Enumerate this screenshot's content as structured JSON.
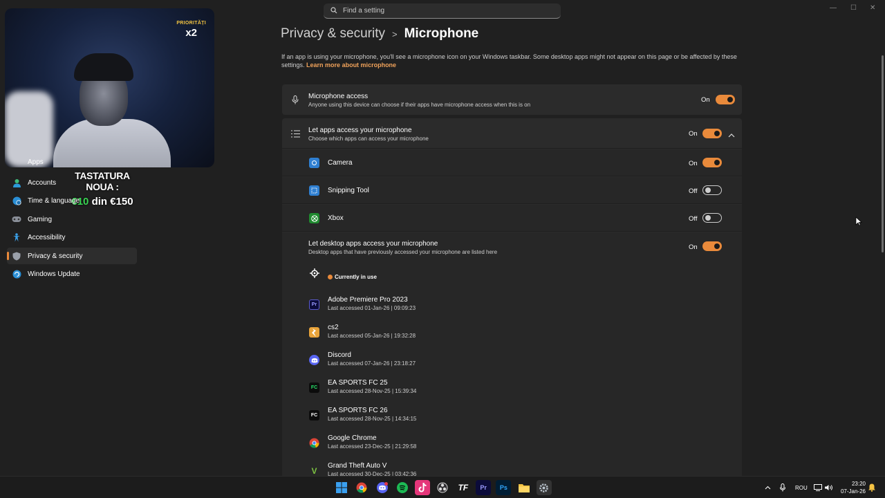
{
  "overlay": {
    "badge_top": "PRIORITĂȚI",
    "badge_bottom": "x2",
    "promo_line1": "TASTATURA NOUA :",
    "promo_highlight": "€10",
    "promo_rest": "din €150"
  },
  "search": {
    "placeholder": "Find a setting"
  },
  "sidebar": {
    "items": [
      {
        "label": "Apps",
        "icon": "apps-icon"
      },
      {
        "label": "Accounts",
        "icon": "accounts-icon"
      },
      {
        "label": "Time & language",
        "icon": "globe-clock-icon"
      },
      {
        "label": "Gaming",
        "icon": "gamepad-icon"
      },
      {
        "label": "Accessibility",
        "icon": "accessibility-icon"
      },
      {
        "label": "Privacy & security",
        "icon": "shield-icon",
        "active": true
      },
      {
        "label": "Windows Update",
        "icon": "update-icon"
      }
    ]
  },
  "header": {
    "parent": "Privacy & security",
    "separator": ">",
    "current": "Microphone",
    "description": "If an app is using your microphone, you'll see a microphone icon on your Windows taskbar. Some desktop apps might not appear on this page or be affected by these settings.",
    "learn_more": "Learn more about microphone"
  },
  "mic_access": {
    "title": "Microphone access",
    "subtitle": "Anyone using this device can choose if their apps have microphone access when this is on",
    "state": "On"
  },
  "let_apps": {
    "title": "Let apps access your microphone",
    "subtitle": "Choose which apps can access your microphone",
    "state": "On"
  },
  "apps": [
    {
      "name": "Camera",
      "state": "On",
      "color": "#2f7fd1"
    },
    {
      "name": "Snipping Tool",
      "state": "Off",
      "color": "#2f7fd1"
    },
    {
      "name": "Xbox",
      "state": "Off",
      "color": "#1f8a2f"
    }
  ],
  "desktop": {
    "title": "Let desktop apps access your microphone",
    "subtitle": "Desktop apps that have previously accessed your microphone are listed here",
    "state": "On",
    "in_use": "Currently in use",
    "apps": [
      {
        "name": "Adobe Premiere Pro 2023",
        "last": "Last accessed 01-Jan-26  |  09:09:23",
        "icon": "Pr"
      },
      {
        "name": "cs2",
        "last": "Last accessed 05-Jan-26  |  19:32:28",
        "icon": "cs"
      },
      {
        "name": "Discord",
        "last": "Last accessed 07-Jan-26  |  23:18:27",
        "icon": "dc"
      },
      {
        "name": "EA SPORTS FC 25",
        "last": "Last accessed 28-Nov-25  |  15:39:34",
        "icon": "FC"
      },
      {
        "name": "EA SPORTS FC 26",
        "last": "Last accessed 28-Nov-25  |  14:34:15",
        "icon": "FC"
      },
      {
        "name": "Google Chrome",
        "last": "Last accessed 23-Dec-25  |  21:29:58",
        "icon": "chrome"
      },
      {
        "name": "Grand Theft Auto V",
        "last": "Last accessed 30-Dec-25  |  03:42:36",
        "icon": "V"
      }
    ]
  },
  "taskbar": {
    "lang": "ROU",
    "time": "23:20",
    "date": "07-Jan-26",
    "icons": [
      "windows-start-icon",
      "chrome-icon",
      "discord-icon",
      "spotify-icon",
      "tiktok-icon",
      "obs-icon",
      "tf-icon",
      "premiere-icon",
      "photoshop-icon",
      "file-explorer-icon",
      "settings-icon"
    ]
  }
}
